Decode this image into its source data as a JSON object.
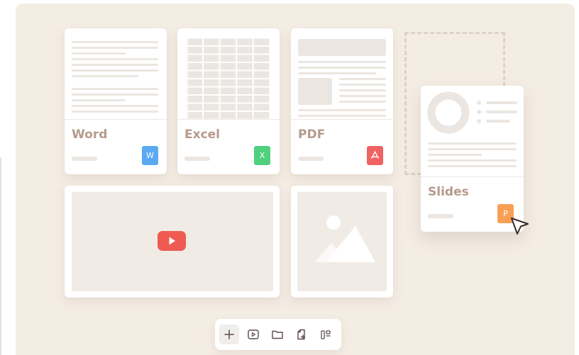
{
  "cards": {
    "word": {
      "label": "Word",
      "badge": "W",
      "color": "#5aa9f2"
    },
    "excel": {
      "label": "Excel",
      "badge": "X",
      "color": "#4fd07d"
    },
    "pdf": {
      "label": "PDF",
      "badge": "",
      "color": "#f06363"
    },
    "slides": {
      "label": "Slides",
      "badge": "P",
      "color": "#f7a054"
    }
  },
  "video": {
    "icon": "play-icon",
    "color": "#ef5b53"
  },
  "image": {
    "icon": "mountain-image-icon"
  },
  "toolbar": {
    "items": [
      "plus-icon",
      "video-icon",
      "folder-icon",
      "add-file-icon",
      "layout-icon"
    ]
  }
}
